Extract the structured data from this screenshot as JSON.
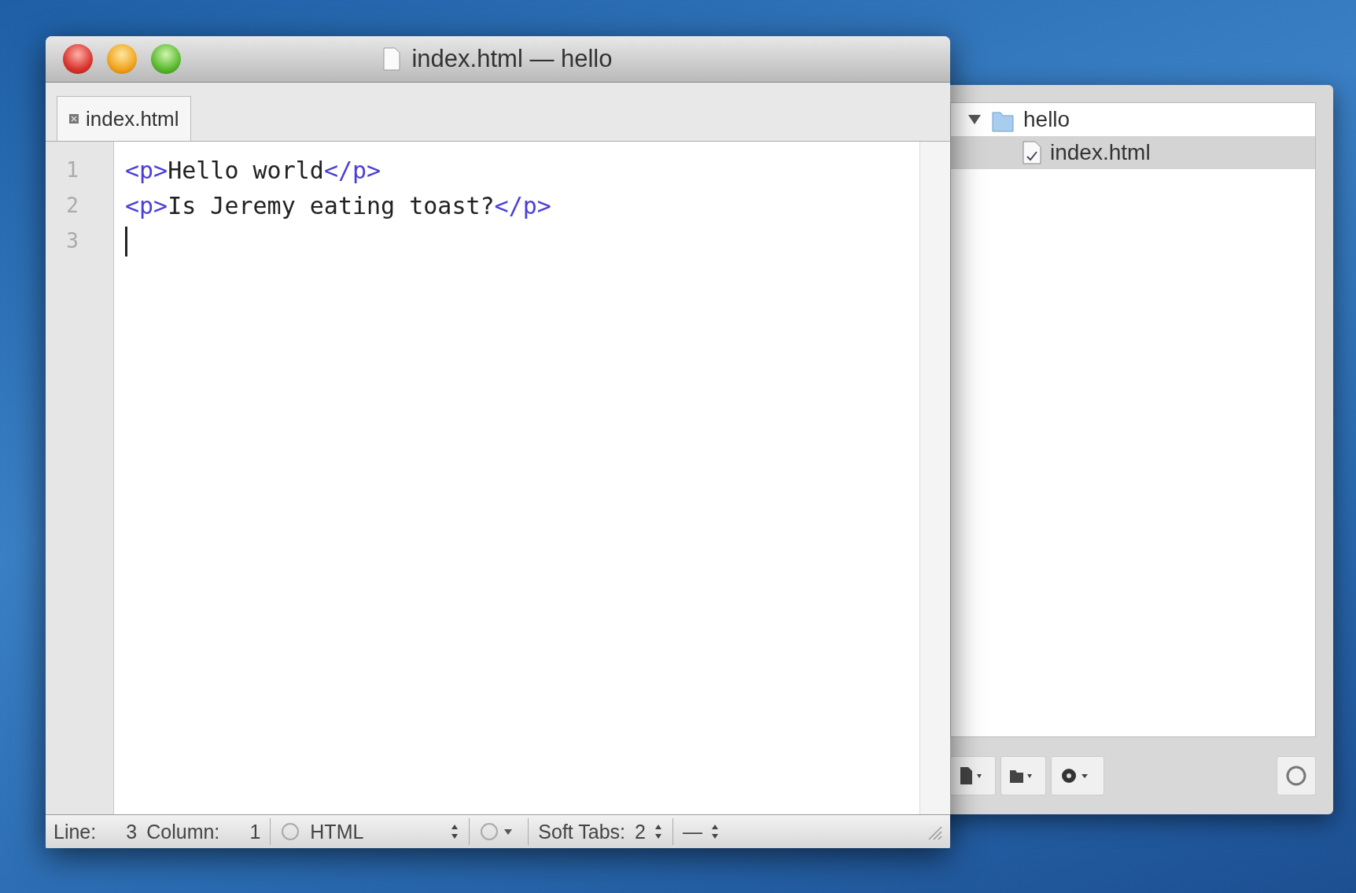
{
  "window": {
    "title": "index.html — hello"
  },
  "tabs": [
    {
      "label": "index.html",
      "selected": true
    }
  ],
  "editor": {
    "lines": [
      {
        "number": "1",
        "cursor": false,
        "tokens": [
          {
            "kind": "tag",
            "text": "<p>"
          },
          {
            "kind": "text",
            "text": "Hello world"
          },
          {
            "kind": "tag",
            "text": "</p>"
          }
        ]
      },
      {
        "number": "2",
        "cursor": false,
        "tokens": [
          {
            "kind": "tag",
            "text": "<p>"
          },
          {
            "kind": "text",
            "text": "Is Jeremy eating toast?"
          },
          {
            "kind": "tag",
            "text": "</p>"
          }
        ]
      },
      {
        "number": "3",
        "cursor": true
      }
    ]
  },
  "status_bar": {
    "line_label": "Line:",
    "line": "3",
    "column_label": "Column:",
    "column": "1",
    "language": "HTML",
    "soft_tabs_label": "Soft Tabs:",
    "tab_size": "2",
    "symbol": "—"
  },
  "drawer": {
    "tree": [
      {
        "label": "hello",
        "kind": "folder",
        "expanded": true,
        "selected": false,
        "children": [
          {
            "label": "index.html",
            "kind": "file",
            "selected": true
          }
        ]
      }
    ]
  }
}
